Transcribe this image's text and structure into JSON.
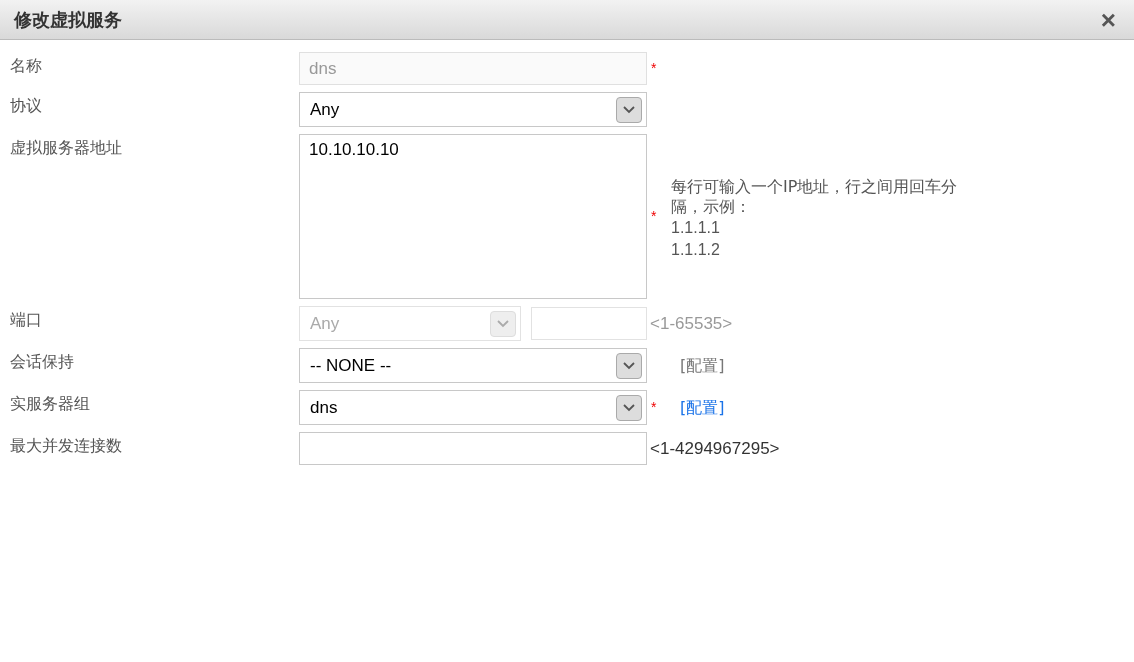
{
  "dialog": {
    "title": "修改虚拟服务",
    "close": "×"
  },
  "fields": [
    {
      "label": "名称",
      "kind": "text",
      "value": "dns",
      "disabled": true,
      "required": "*"
    },
    {
      "label": "协议",
      "kind": "select",
      "value": "Any",
      "disabled": false
    },
    {
      "label": "虚拟服务器地址",
      "kind": "textarea",
      "value": "10.10.10.10",
      "required": "*",
      "hint": "每行可输入一个IP地址，行之间用回车分隔，示例：",
      "examples": [
        "1.1.1.1",
        "1.1.1.2"
      ]
    },
    {
      "label": "端口",
      "kind": "port",
      "value": "Any",
      "disabled": true,
      "range": "<1-65535>"
    },
    {
      "label": "会话保持",
      "kind": "select",
      "value": "-- NONE --",
      "disabled": false,
      "link": {
        "text": "[配置]",
        "disabled": true
      }
    },
    {
      "label": "实服务器组",
      "kind": "select",
      "value": "dns",
      "disabled": false,
      "required": "*",
      "link": {
        "text": "[配置]",
        "disabled": false
      }
    },
    {
      "label": "最大并发连接数",
      "kind": "text",
      "disabled": false,
      "range": "<1-4294967295>"
    }
  ]
}
